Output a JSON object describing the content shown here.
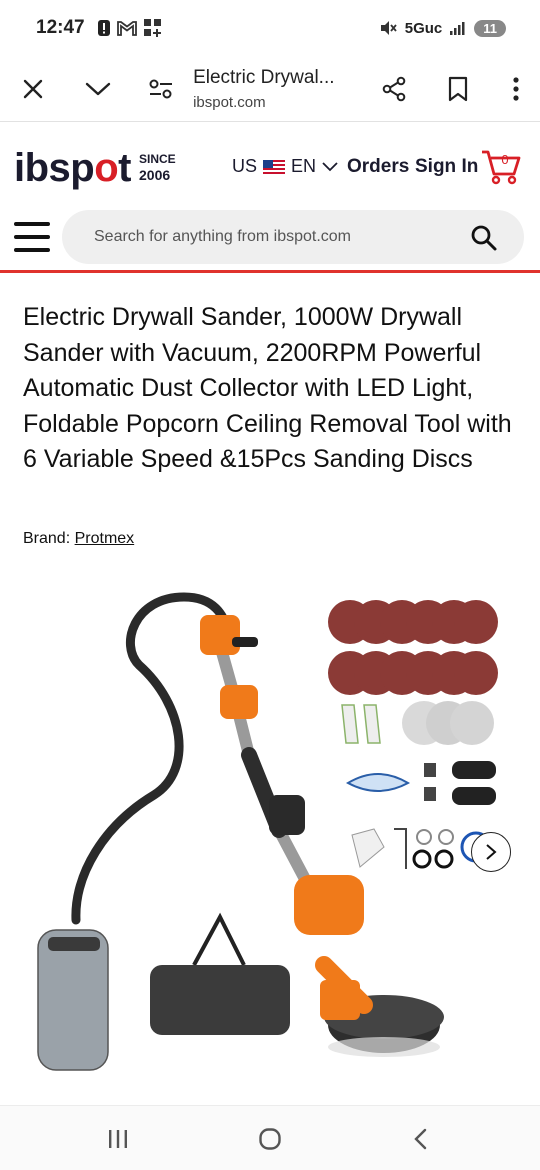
{
  "status_bar": {
    "time": "12:47",
    "network": "5Guc",
    "battery": "11",
    "icons": [
      "alert-icon",
      "gmail-icon",
      "apps-icon",
      "mute-icon",
      "signal-icon"
    ]
  },
  "browser": {
    "page_title": "Electric Drywal...",
    "url": "ibspot.com",
    "icons": [
      "close-icon",
      "chevron-down-icon",
      "tune-icon",
      "share-icon",
      "bookmark-icon",
      "more-icon"
    ]
  },
  "header": {
    "logo_part1": "ibsp",
    "logo_o": "o",
    "logo_part2": "t",
    "since_label": "SINCE",
    "since_year": "2006",
    "country": "US",
    "language": "EN",
    "orders": "Orders",
    "sign_in": "Sign In",
    "cart_count": "0",
    "accent_color": "#d81f26"
  },
  "search": {
    "placeholder": "Search for anything from ibspot.com"
  },
  "product": {
    "title": "Electric Drywall Sander, 1000W Drywall Sander with Vacuum, 2200RPM Powerful Automatic Dust Collector with LED Light, Foldable Popcorn Ceiling Removal Tool with 6 Variable Speed &15Pcs Sanding Discs",
    "brand_label": "Brand: ",
    "brand_name": "Protmex"
  },
  "nav": {
    "icons": [
      "recent-apps-icon",
      "home-icon",
      "back-icon"
    ]
  }
}
